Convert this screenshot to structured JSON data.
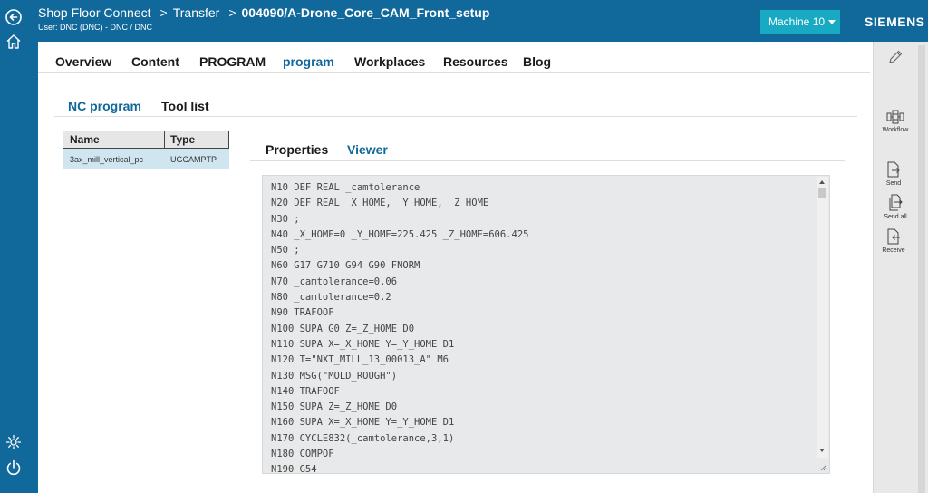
{
  "header": {
    "app_name": "Shop Floor Connect",
    "breadcrumb_transfer": "Transfer",
    "current_item": "004090/A-Drone_Core_CAM_Front_setup",
    "user_line": "User: DNC (DNC) - DNC / DNC",
    "machine_button": "Machine 10",
    "brand": "SIEMENS"
  },
  "main_tabs": [
    "Overview",
    "Content",
    "PROGRAM",
    "program",
    "Workplaces",
    "Resources",
    "Blog"
  ],
  "sub_tabs": [
    "NC program",
    "Tool list"
  ],
  "program_table": {
    "columns": [
      "Name",
      "Type"
    ],
    "rows": [
      {
        "name": "3ax_mill_vertical_pc",
        "type": "UGCAMPTP"
      }
    ]
  },
  "viewer_tabs": [
    "Properties",
    "Viewer"
  ],
  "code_lines": [
    "N10 DEF REAL _camtolerance",
    "N20 DEF REAL _X_HOME, _Y_HOME, _Z_HOME",
    "N30 ;",
    "N40 _X_HOME=0 _Y_HOME=225.425 _Z_HOME=606.425",
    "N50 ;",
    "N60 G17 G710 G94 G90 FNORM",
    "N70 _camtolerance=0.06",
    "N80 _camtolerance=0.2",
    "N90 TRAFOOF",
    "N100 SUPA G0 Z=_Z_HOME D0",
    "N110 SUPA X=_X_HOME Y=_Y_HOME D1",
    "N120 T=\"NXT_MILL_13_00013_A\" M6",
    "N130 MSG(\"MOLD_ROUGH\")",
    "N140 TRAFOOF",
    "N150 SUPA Z=_Z_HOME D0",
    "N160 SUPA X=_X_HOME Y=_Y_HOME D1",
    "N170 CYCLE832(_camtolerance,3,1)",
    "N180 COMPOF",
    "N190 G54"
  ],
  "right_actions": {
    "workflow": "Workflow",
    "send": "Send",
    "send_all": "Send all",
    "receive": "Receive"
  },
  "colors": {
    "primary": "#11689a",
    "accent_button": "#19aac3",
    "selected_row": "#cfe6f0",
    "viewer_bg": "#e7e9ea"
  },
  "icons": [
    "back-arrow-icon",
    "home-icon",
    "settings-gear-icon",
    "power-icon",
    "pencil-icon",
    "workflow-icon",
    "send-icon",
    "send-all-icon",
    "receive-icon"
  ]
}
